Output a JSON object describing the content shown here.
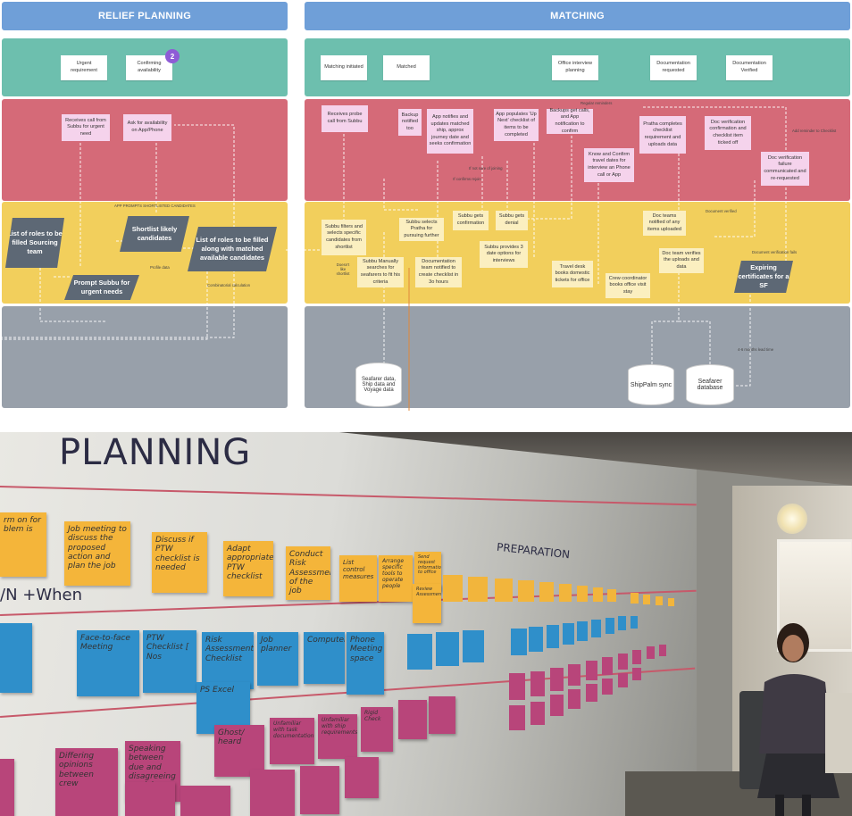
{
  "headers": {
    "relief": "RELIEF PLANNING",
    "matching": "MATCHING"
  },
  "milestones": {
    "urgent": "Urgent requirement",
    "confirming": "Confirming availability",
    "badge": "2",
    "initiated": "Matching initiated",
    "matched": "Matched",
    "office": "Office interview planning",
    "docreq": "Documentation requested",
    "docver": "Documentation Verified"
  },
  "red": {
    "receives_call": "Receives call from Subbu for urgent need",
    "ask_avail": "Ask for availability on App/Phone",
    "probe": "Receives probe call from Subbu",
    "backup_notified": "Backup notified too",
    "app_notifies": "App notifies and updates matched ship, approx journey date and seeks confirmation",
    "app_populates": "App populates 'Up Next' checklist of items to be completed",
    "backups_calls": "Backups get calls, and App notification to confirm",
    "pratha": "Pratha completes checklist requirement and uploads data",
    "doc_verif": "Doc verification confirmation and checklist item ticked off",
    "know_confirm": "Know and Confirm travel dates for interview an Phone call or App",
    "doc_fail": "Doc verification failure communicated and re-requested"
  },
  "yellow": {
    "list_roles": "List of roles to be filled Sourcing team",
    "shortlist": "Shortlist likely candidates",
    "list_matched": "List of roles to be filled along with matched available candidates",
    "prompt": "Prompt Subbu for urgent needs",
    "subbu_filters": "Subbu filters and selects specific candidates from shortlist",
    "subbu_manual": "Subbu Manually searches for seafarers to fit his criteria",
    "subbu_selects": "Subbu selects Pratha for pursuing further",
    "subbu_conf": "Subbu gets confirmation",
    "subbu_denial": "Subbu gets denial",
    "subbu_3dates": "Subbu provides 3 date options for interviews",
    "doc_team": "Documentation team notified to create checklist in 3o hours",
    "travel": "Travel desk books domestic tickets for office",
    "crew": "Crew coordinator books office visit stay",
    "doc_notified": "Doc teams notified of any items uploaded",
    "doc_verifies": "Doc team verifies the uploads and data",
    "expiring": "Expiring certificates for a SF"
  },
  "grey": {
    "seafarer_data": "Seafarer data, Ship data and Voyage data",
    "shippalm": "ShipPalm sync",
    "seafarer_db": "Seafarer database"
  },
  "notes": {
    "app_prompts": "APP PROMPTS SHORTLISTED CANDIDATES",
    "profile": "Profile data",
    "combinatorial": "Combinatorial calculation",
    "doesnt_like": "Doesn't like shortlist",
    "regular": "Regular reminders",
    "not_sure": "If not sure of joining",
    "if_confirms": "If confirms rejoin",
    "doc_verified": "Document verified",
    "doc_fails": "Document verification fails",
    "add_reminder": "Add reminder to Checklist",
    "months": "4-6 months lead time"
  },
  "photo": {
    "heading": "PLANNING",
    "yn": "/N  +When",
    "preparation": "PREPARATION",
    "orange": [
      "rm on for blem is",
      "Job meeting to discuss the proposed action and plan the job",
      "Discuss if PTW checklist is needed",
      "Adapt appropriate PTW checklist",
      "Conduct Risk Assessment of the job",
      "List control measures",
      "Arrange specific tools to operate people",
      "Send request information to office",
      "Review Assessment"
    ],
    "blue": [
      "Face-to-face Meeting",
      "PTW Checklist [ Nos",
      "Risk Assessment Checklist",
      "Job planner",
      "Computer",
      "Phone Meeting space",
      "PS Excel"
    ],
    "magenta": [
      "Differing opinions between crew",
      "Speaking between due and disagreeing on risk",
      "Ghost/ heard",
      "Unfamiliar with task documentation",
      "Unfamiliar with ship requirements",
      "Rigid Check"
    ]
  },
  "colors": {
    "header": "#6f9fd8",
    "teal": "#6dbfae",
    "red": "#d56a78",
    "yellow": "#f2cf5c",
    "grey": "#98a0aa",
    "pink": "#f5d3ec",
    "dark": "#5d6875",
    "badge": "#8e5cd6"
  }
}
